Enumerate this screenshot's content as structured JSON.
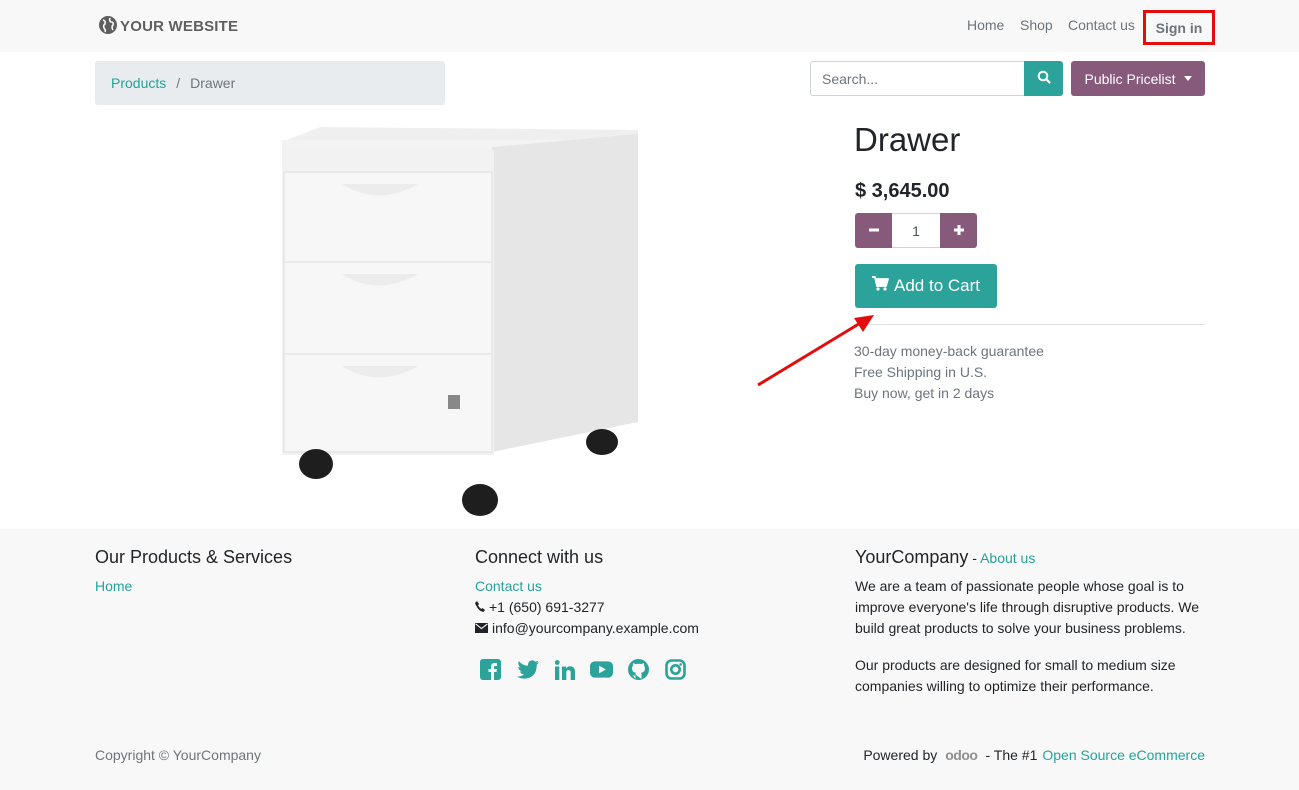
{
  "header": {
    "logo_text": "YOUR WEBSITE",
    "nav": {
      "home": "Home",
      "shop": "Shop",
      "contact": "Contact us",
      "signin": "Sign in"
    }
  },
  "breadcrumb": {
    "parent": "Products",
    "separator": "/",
    "current": "Drawer"
  },
  "search": {
    "placeholder": "Search...",
    "pricelist_label": "Public Pricelist"
  },
  "product": {
    "name": "Drawer",
    "price": "$ 3,645.00",
    "quantity": "1",
    "add_to_cart_label": "Add to Cart",
    "perks": [
      "30-day money-back guarantee",
      "Free Shipping in U.S.",
      "Buy now, get in 2 days"
    ]
  },
  "footer": {
    "col1": {
      "title": "Our Products & Services",
      "links": [
        "Home"
      ]
    },
    "col2": {
      "title": "Connect with us",
      "contact_link": "Contact us",
      "phone": "+1 (650) 691-3277",
      "email": "info@yourcompany.example.com",
      "social_icons": [
        "facebook-icon",
        "twitter-icon",
        "linkedin-icon",
        "youtube-icon",
        "github-icon",
        "instagram-icon"
      ]
    },
    "col3": {
      "title": "YourCompany",
      "separator": " - ",
      "about_link": "About us",
      "para1": "We are a team of passionate people whose goal is to improve everyone's life through disruptive products. We build great products to solve your business problems.",
      "para2": "Our products are designed for small to medium size companies willing to optimize their performance."
    },
    "copyright": "Copyright © YourCompany",
    "powered_prefix": "Powered by",
    "odoo_logo": "odoo",
    "powered_middle": "- The #1",
    "powered_link": "Open Source eCommerce"
  },
  "colors": {
    "accent": "#2ca39a",
    "brand_purple": "#875a7b",
    "highlight_red": "#e20e0e"
  }
}
